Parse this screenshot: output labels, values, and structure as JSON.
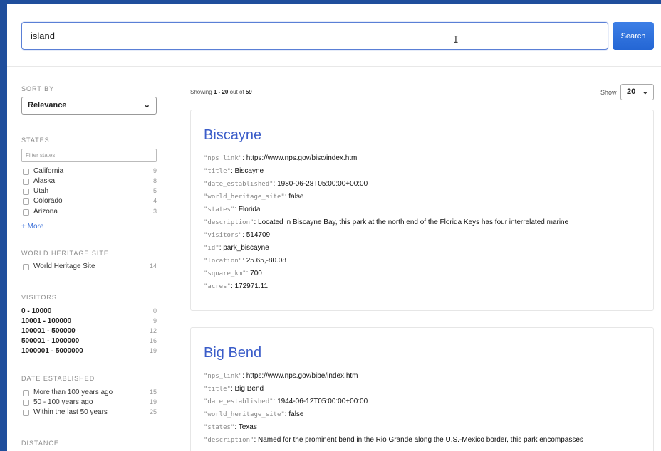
{
  "search": {
    "value": "island",
    "button_label": "Search"
  },
  "sidebar": {
    "sort": {
      "title": "SORT BY",
      "selected": "Relevance"
    },
    "states": {
      "title": "STATES",
      "filter_placeholder": "Filter states",
      "items": [
        {
          "label": "California",
          "count": "9"
        },
        {
          "label": "Alaska",
          "count": "8"
        },
        {
          "label": "Utah",
          "count": "5"
        },
        {
          "label": "Colorado",
          "count": "4"
        },
        {
          "label": "Arizona",
          "count": "3"
        }
      ],
      "more_label": "+ More"
    },
    "world_heritage": {
      "title": "WORLD HERITAGE SITE",
      "items": [
        {
          "label": "World Heritage Site",
          "count": "14"
        }
      ]
    },
    "visitors": {
      "title": "VISITORS",
      "items": [
        {
          "label": "0 - 10000",
          "count": "0"
        },
        {
          "label": "10001 - 100000",
          "count": "9"
        },
        {
          "label": "100001 - 500000",
          "count": "12"
        },
        {
          "label": "500001 - 1000000",
          "count": "16"
        },
        {
          "label": "1000001 - 5000000",
          "count": "19"
        }
      ]
    },
    "date_established": {
      "title": "DATE ESTABLISHED",
      "items": [
        {
          "label": "More than 100 years ago",
          "count": "15"
        },
        {
          "label": "50 - 100 years ago",
          "count": "19"
        },
        {
          "label": "Within the last 50 years",
          "count": "25"
        }
      ]
    },
    "distance": {
      "title": "DISTANCE"
    }
  },
  "results": {
    "showing_prefix": "Showing ",
    "showing_range": "1 - 20",
    "showing_mid": " out of ",
    "showing_total": "59",
    "show_label": "Show",
    "show_value": "20",
    "cards": [
      {
        "title": "Biscayne",
        "fields": [
          {
            "key": "\"nps_link\"",
            "value": "https://www.nps.gov/bisc/index.htm"
          },
          {
            "key": "\"title\"",
            "value": "Biscayne"
          },
          {
            "key": "\"date_established\"",
            "value": "1980-06-28T05:00:00+00:00"
          },
          {
            "key": "\"world_heritage_site\"",
            "value": "false"
          },
          {
            "key": "\"states\"",
            "value": "Florida"
          },
          {
            "key": "\"description\"",
            "value": "Located in Biscayne Bay, this park at the north end of the Florida Keys has four interrelated marine"
          },
          {
            "key": "\"visitors\"",
            "value": "514709"
          },
          {
            "key": "\"id\"",
            "value": "park_biscayne"
          },
          {
            "key": "\"location\"",
            "value": "25.65,-80.08"
          },
          {
            "key": "\"square_km\"",
            "value": "700"
          },
          {
            "key": "\"acres\"",
            "value": "172971.11"
          }
        ]
      },
      {
        "title": "Big Bend",
        "fields": [
          {
            "key": "\"nps_link\"",
            "value": "https://www.nps.gov/bibe/index.htm"
          },
          {
            "key": "\"title\"",
            "value": "Big Bend"
          },
          {
            "key": "\"date_established\"",
            "value": "1944-06-12T05:00:00+00:00"
          },
          {
            "key": "\"world_heritage_site\"",
            "value": "false"
          },
          {
            "key": "\"states\"",
            "value": "Texas"
          },
          {
            "key": "\"description\"",
            "value": "Named for the prominent bend in the Rio Grande along the U.S.-Mexico border, this park encompasses"
          }
        ]
      }
    ]
  }
}
